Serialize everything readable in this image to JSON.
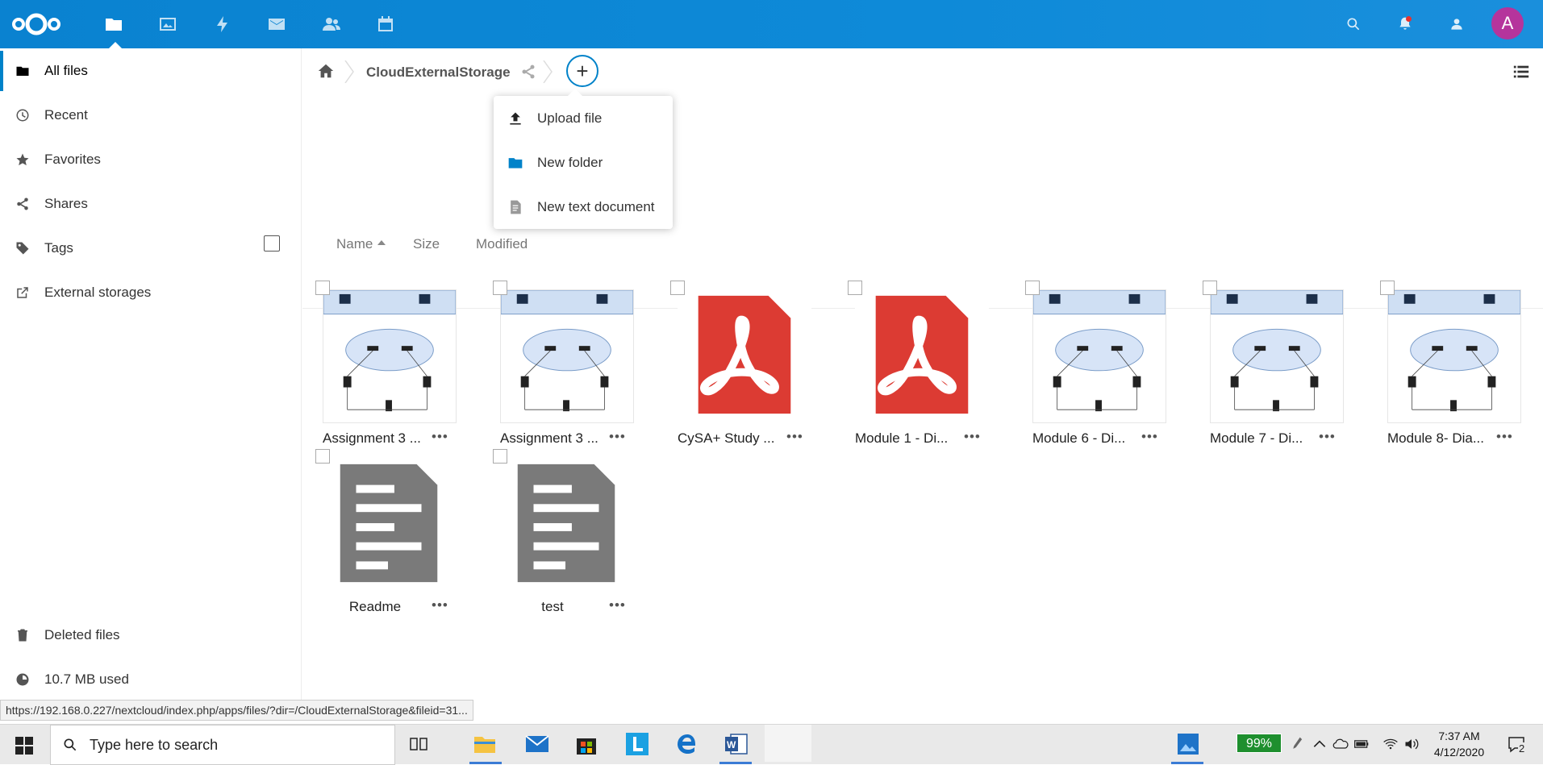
{
  "header": {
    "apps": [
      "files-icon",
      "photos-icon",
      "activity-icon",
      "mail-icon",
      "contacts-icon",
      "calendar-icon"
    ],
    "avatar_letter": "A",
    "avatar_color": "#b5349c",
    "accent": "#0082c9"
  },
  "sidebar": {
    "items": [
      {
        "label": "All files",
        "icon": "folder-icon"
      },
      {
        "label": "Recent",
        "icon": "clock-icon"
      },
      {
        "label": "Favorites",
        "icon": "star-icon"
      },
      {
        "label": "Shares",
        "icon": "share-icon"
      },
      {
        "label": "Tags",
        "icon": "tag-icon"
      },
      {
        "label": "External storages",
        "icon": "external-link-icon"
      }
    ],
    "deleted_files": "Deleted files",
    "quota": "10.7 MB used"
  },
  "breadcrumb": {
    "current": "CloudExternalStorage"
  },
  "new_menu": {
    "items": [
      {
        "label": "Upload file",
        "icon": "upload-icon"
      },
      {
        "label": "New folder",
        "icon": "folder-icon"
      },
      {
        "label": "New text document",
        "icon": "text-file-icon"
      }
    ]
  },
  "columns": {
    "name": "Name",
    "size": "Size",
    "modified": "Modified"
  },
  "files": [
    {
      "name": "Assignment 3 ...",
      "type": "diagram"
    },
    {
      "name": "Assignment 3 ...",
      "type": "diagram"
    },
    {
      "name": "CySA+ Study ...",
      "type": "pdf"
    },
    {
      "name": "Module 1 - Di...",
      "type": "pdf"
    },
    {
      "name": "Module 6 - Di...",
      "type": "diagram"
    },
    {
      "name": "Module 7 - Di...",
      "type": "diagram"
    },
    {
      "name": "Module 8- Dia...",
      "type": "diagram"
    },
    {
      "name": "Readme",
      "type": "text"
    },
    {
      "name": "test",
      "type": "text"
    }
  ],
  "more_label": "•••",
  "status_url": "https://192.168.0.227/nextcloud/index.php/apps/files/?dir=/CloudExternalStorage&fileid=31...",
  "taskbar": {
    "search_placeholder": "Type here to search",
    "battery": "99%",
    "time": "7:37 AM",
    "date": "4/12/2020",
    "notifications": "2"
  }
}
